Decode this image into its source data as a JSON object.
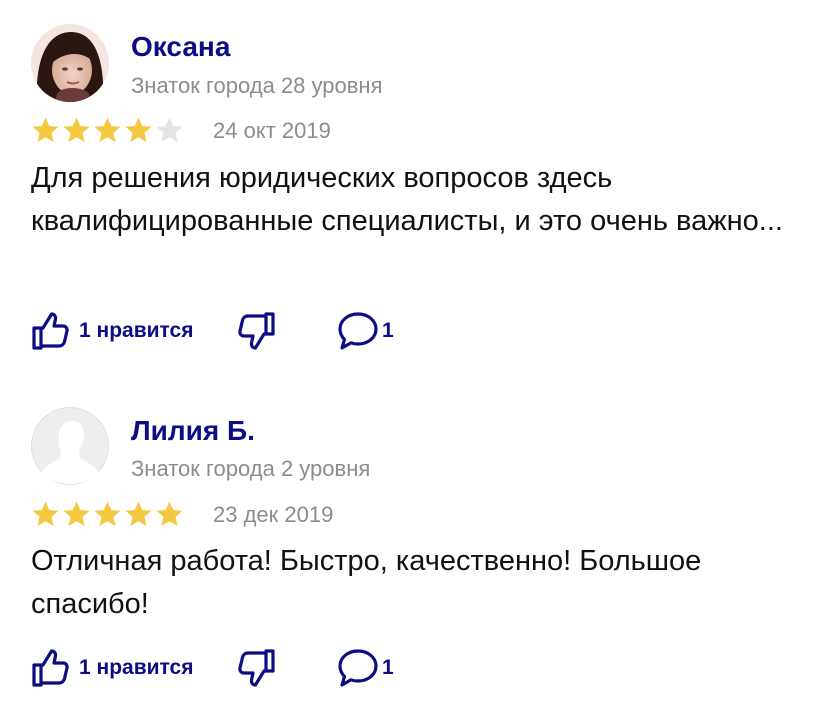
{
  "reviews": [
    {
      "author": "Оксана",
      "level": "Знаток города 28 уровня",
      "rating": 4,
      "max_rating": 5,
      "date": "24 окт 2019",
      "text": "Для решения юридических вопросов здесь квалифицированные специалисты, и это очень важно...",
      "like_label": "1 нравится",
      "comments": "1"
    },
    {
      "author": "Лилия Б.",
      "level": "Знаток города 2 уровня",
      "rating": 5,
      "max_rating": 5,
      "date": "23 дек 2019",
      "text": "Отличная работа! Быстро, качественно! Большое спасибо!",
      "like_label": "1 нравится",
      "comments": "1"
    }
  ],
  "colors": {
    "accent": "#0c0c84",
    "star_filled": "#f5c842",
    "star_empty": "#e3e3e3",
    "secondary_text": "#8c8c8c"
  }
}
